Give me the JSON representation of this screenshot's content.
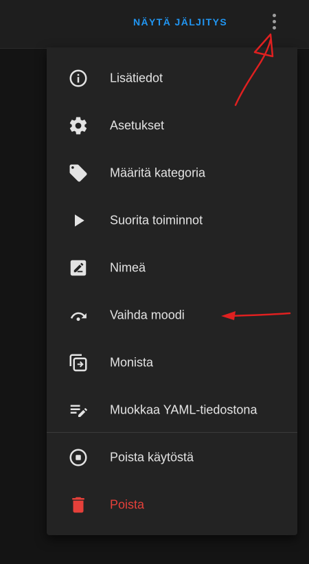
{
  "header": {
    "trace_label": "NÄYTÄ JÄLJITYS",
    "more_icon": "more-vertical-icon",
    "accent_color": "#2196f3"
  },
  "menu": {
    "items": [
      {
        "label": "Lisätiedot",
        "icon": "info-icon"
      },
      {
        "label": "Asetukset",
        "icon": "gear-icon"
      },
      {
        "label": "Määritä kategoria",
        "icon": "tag-icon"
      },
      {
        "label": "Suorita toiminnot",
        "icon": "play-icon"
      },
      {
        "label": "Nimeä",
        "icon": "rename-icon"
      },
      {
        "label": "Vaihda moodi",
        "icon": "redo-icon"
      },
      {
        "label": "Monista",
        "icon": "duplicate-icon"
      },
      {
        "label": "Muokkaa YAML-tiedostona",
        "icon": "edit-list-icon"
      },
      {
        "label": "Poista käytöstä",
        "icon": "stop-circle-icon"
      },
      {
        "label": "Poista",
        "icon": "trash-icon",
        "color": "#e5403a"
      }
    ]
  },
  "annotations": {
    "color": "#e02020"
  }
}
